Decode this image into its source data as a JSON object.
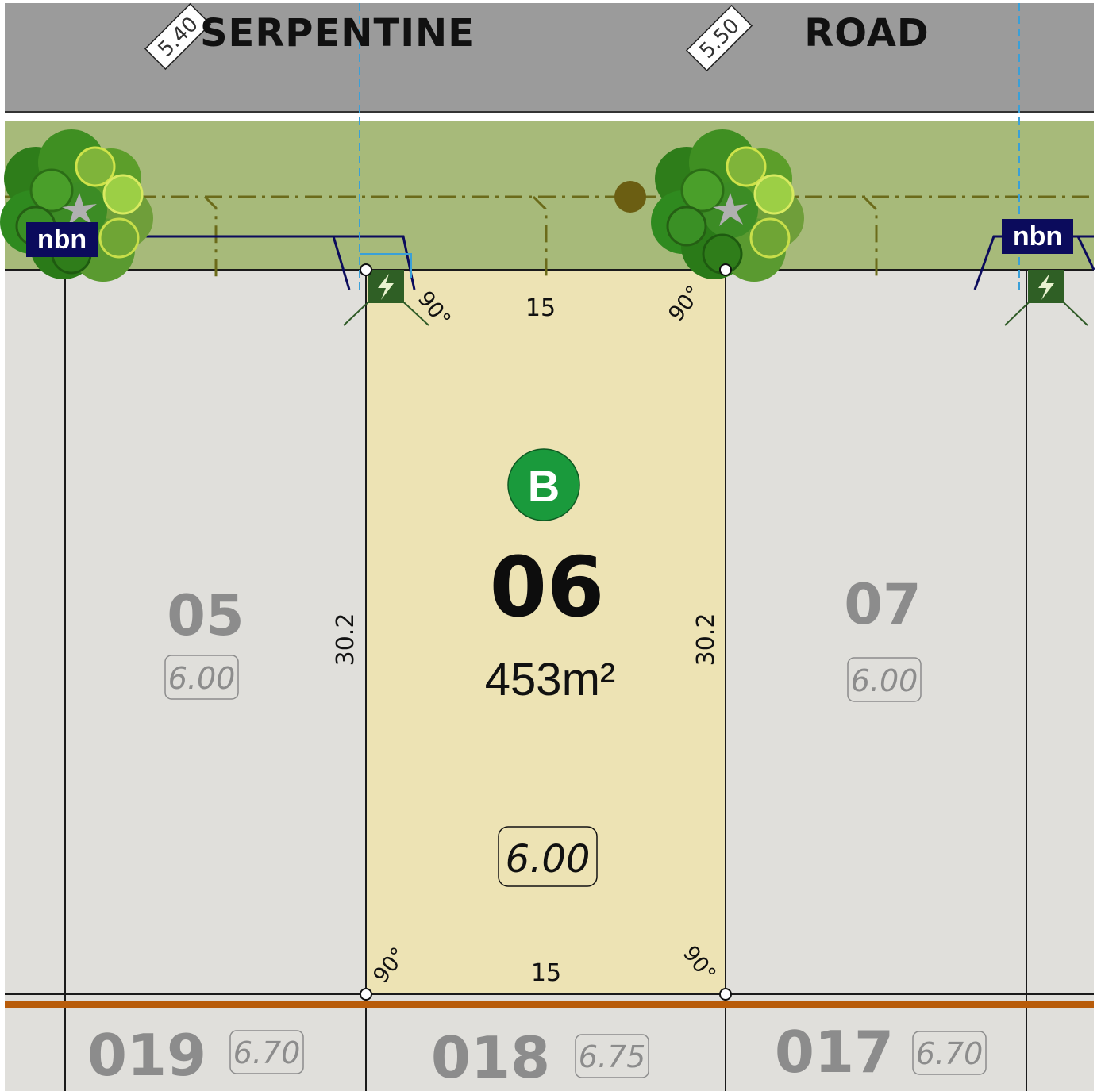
{
  "road": {
    "name_left": "SERPENTINE",
    "name_right": "ROAD",
    "level_left": "5.40",
    "level_right": "5.50"
  },
  "main_lot": {
    "number": "06",
    "area": "453m²",
    "badge": "B",
    "rl": "6.00",
    "frontage": "15",
    "rear": "15",
    "depth_left": "30.2",
    "depth_right": "30.2",
    "angles": [
      "90°",
      "90°",
      "90°",
      "90°"
    ]
  },
  "neighbour_lots": [
    {
      "number": "05",
      "rl": "6.00"
    },
    {
      "number": "07",
      "rl": "6.00"
    }
  ],
  "rear_lots": [
    {
      "number": "019",
      "rl": "6.70"
    },
    {
      "number": "018",
      "rl": "6.75"
    },
    {
      "number": "017",
      "rl": "6.70"
    }
  ],
  "nbn": [
    "nbn",
    "nbn"
  ],
  "icons": [
    "tree-icon",
    "power-pit-icon",
    "nbn-pit-icon",
    "street-light-icon"
  ],
  "colors": {
    "road": "#9b9b9b",
    "verge": "#a7ba7a",
    "main_lot": "#ede3b4",
    "other_lot": "#e0dfdb",
    "rear_boundary": "#b85c0a",
    "badge": "#1a9a3c",
    "nbn": "#0b0b5c",
    "service_line": "#6b6b1a"
  }
}
